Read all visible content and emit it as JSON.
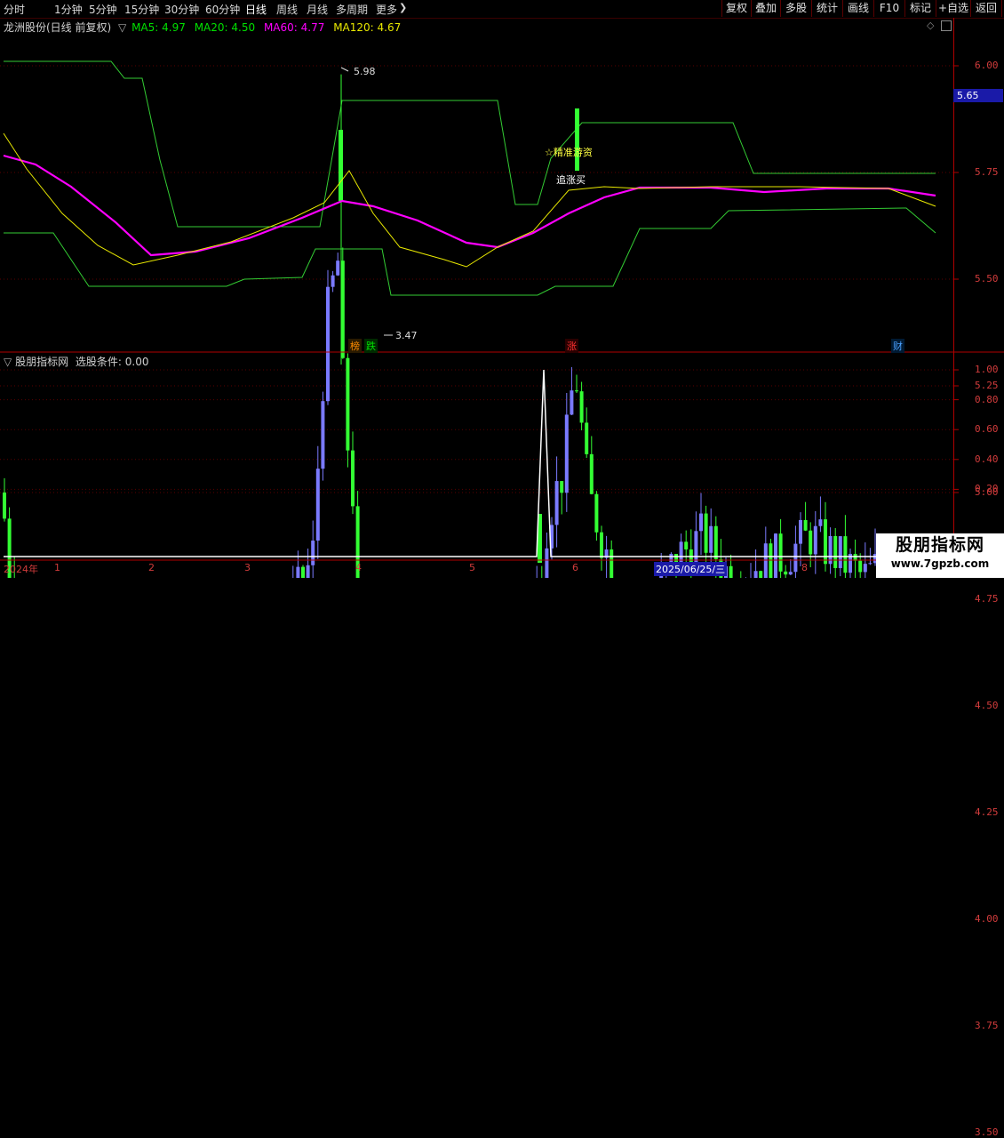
{
  "toolbar": {
    "periods": [
      "分时",
      "1分钟",
      "5分钟",
      "15分钟",
      "30分钟",
      "60分钟",
      "日线",
      "周线",
      "月线",
      "多周期",
      "更多"
    ],
    "active_period": "日线",
    "more_arrow": "chevron-right-icon",
    "buttons": [
      "复权",
      "叠加",
      "多股",
      "统计",
      "画线",
      "F10",
      "标记",
      "+自选",
      "返回"
    ]
  },
  "main_panel": {
    "stock_title": "龙洲股份(日线 前复权)",
    "ma": [
      {
        "label": "MA5: 4.97",
        "color": "#ffffff"
      },
      {
        "label": "MA20: 4.50",
        "color": "#e8e800"
      },
      {
        "label": "MA60: 4.77",
        "color": "#ff00ff"
      },
      {
        "label": "MA120: 4.67",
        "color": "#00e000"
      }
    ],
    "y_ticks": [
      "6.00",
      "5.75",
      "5.50",
      "5.25",
      "5.00",
      "4.75",
      "4.50",
      "4.25",
      "4.00",
      "3.75",
      "3.50"
    ],
    "current_price": "5.65",
    "high_label": "5.98",
    "low_label": "3.47",
    "annotations": [
      "☆精准游资",
      "追涨买"
    ],
    "event_tags": [
      {
        "text": "榜",
        "color": "#ff8c00"
      },
      {
        "text": "跌",
        "color": "#00e000"
      },
      {
        "text": "涨",
        "color": "#ff3030"
      },
      {
        "text": "财",
        "color": "#4aa0ff"
      }
    ]
  },
  "indicator_panel": {
    "title": "股朋指标网",
    "condition": "选股条件: 0.00",
    "y_ticks": [
      "1.00",
      "0.80",
      "0.60",
      "0.40",
      "0.20"
    ]
  },
  "time_axis": {
    "labels": [
      "2024年",
      "1",
      "2",
      "3",
      "4",
      "5",
      "6",
      "2025/06/25/三",
      "8"
    ]
  },
  "watermark": {
    "line1": "股朋指标网",
    "line2": "www.7gpzb.com"
  },
  "colors": {
    "up": "#ff3030",
    "down_fill": "#00e0e0",
    "bull": "#7a7aff",
    "bear": "#33ff33",
    "axis": "#b00000",
    "grid": "#5a0000"
  }
}
